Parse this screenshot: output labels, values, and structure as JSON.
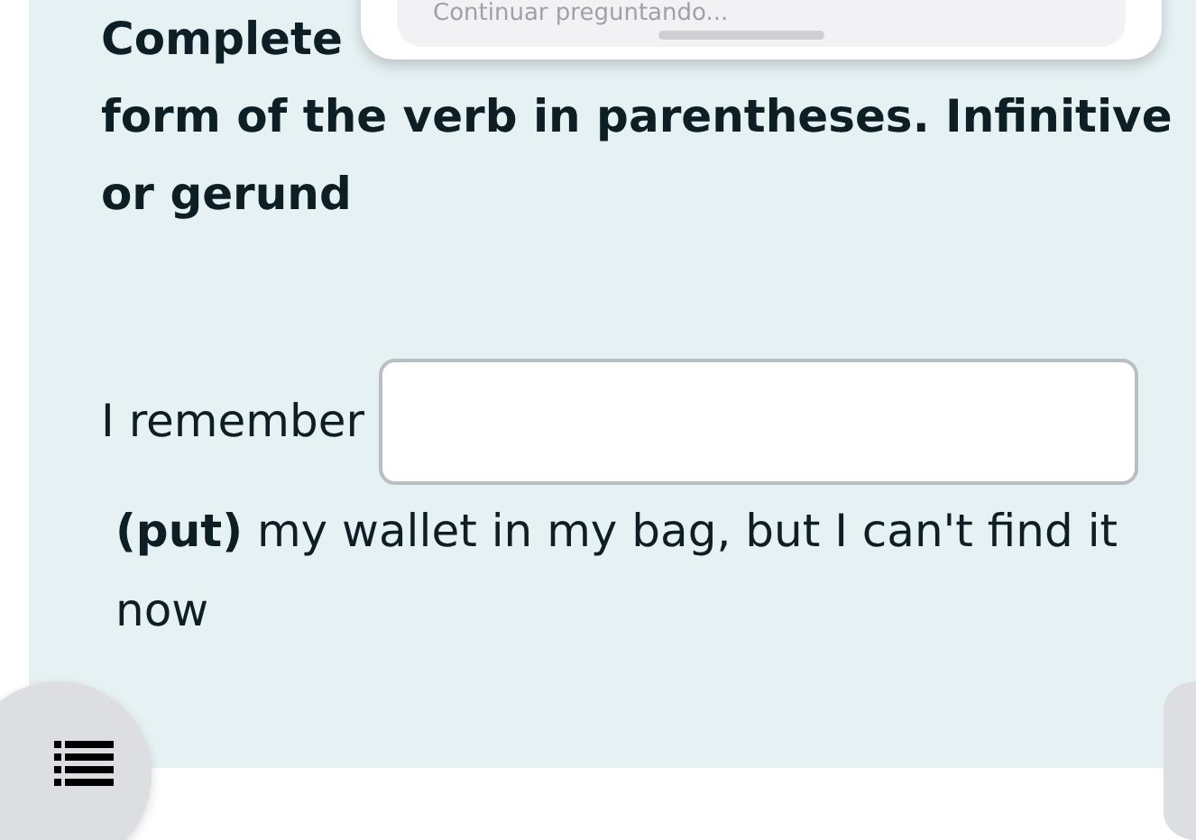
{
  "popup": {
    "text": "Continuar preguntando..."
  },
  "instruction": {
    "lead": "Complete",
    "rest": "form of the verb in parentheses. Infinitive or gerund"
  },
  "exercise": {
    "before": "I remember",
    "after": "**(put)** my wallet in my bag, but I can't find it now"
  }
}
